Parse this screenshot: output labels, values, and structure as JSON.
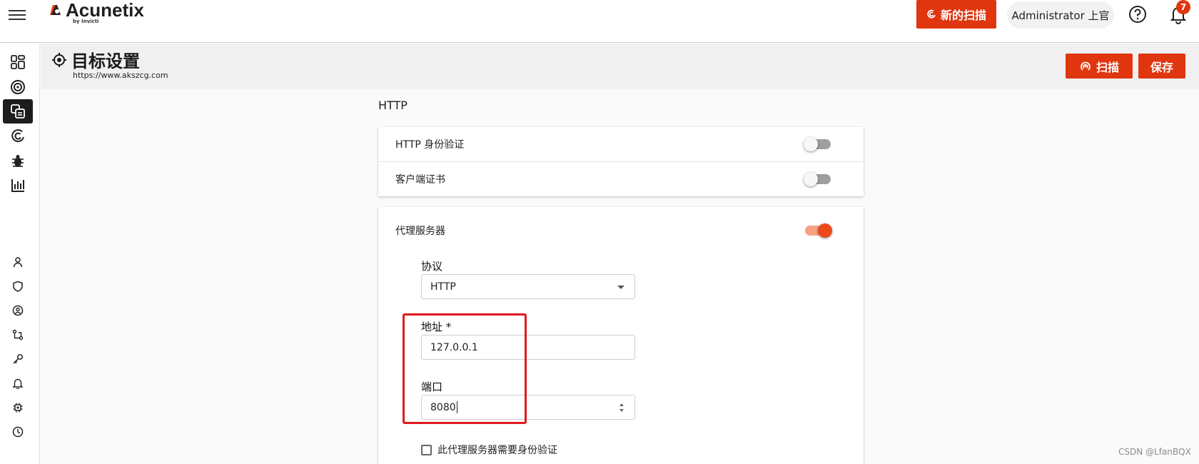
{
  "topbar": {
    "logo_text": "Acunetix",
    "logo_sub": "by Invicti",
    "new_scan_label": "新的扫描",
    "user_label": "Administrator 上官",
    "notification_count": "7",
    "accent_color": "#e0360f"
  },
  "sidebar": {
    "items": [
      {
        "icon": "dashboard-icon",
        "active": false
      },
      {
        "icon": "target-icon",
        "active": false
      },
      {
        "icon": "targets-icon",
        "active": true
      },
      {
        "icon": "scans-icon",
        "active": false
      },
      {
        "icon": "bug-icon",
        "active": false
      },
      {
        "icon": "reports-icon",
        "active": false
      },
      {
        "icon": "user-icon",
        "active": false
      },
      {
        "icon": "shield-icon",
        "active": false
      },
      {
        "icon": "role-icon",
        "active": false
      },
      {
        "icon": "integrations-icon",
        "active": false
      },
      {
        "icon": "key-icon",
        "active": false
      },
      {
        "icon": "bell-icon",
        "active": false
      },
      {
        "icon": "settings-icon",
        "active": false
      },
      {
        "icon": "history-icon",
        "active": false
      }
    ]
  },
  "header": {
    "title": "目标设置",
    "url": "https://www.akszcg.com",
    "scan_label": "扫描",
    "save_label": "保存"
  },
  "http_section": {
    "label": "HTTP",
    "rows": [
      {
        "label": "HTTP 身份验证",
        "enabled": false
      },
      {
        "label": "客户端证书",
        "enabled": false
      }
    ]
  },
  "proxy": {
    "label": "代理服务器",
    "enabled": true,
    "protocol_label": "协议",
    "protocol_value": "HTTP",
    "address_label": "地址 *",
    "address_value": "127.0.0.1",
    "port_label": "端口",
    "port_value": "8080",
    "auth_checkbox_label": "此代理服务器需要身份验证",
    "auth_checked": false
  },
  "watermark": "CSDN @LfanBQX"
}
